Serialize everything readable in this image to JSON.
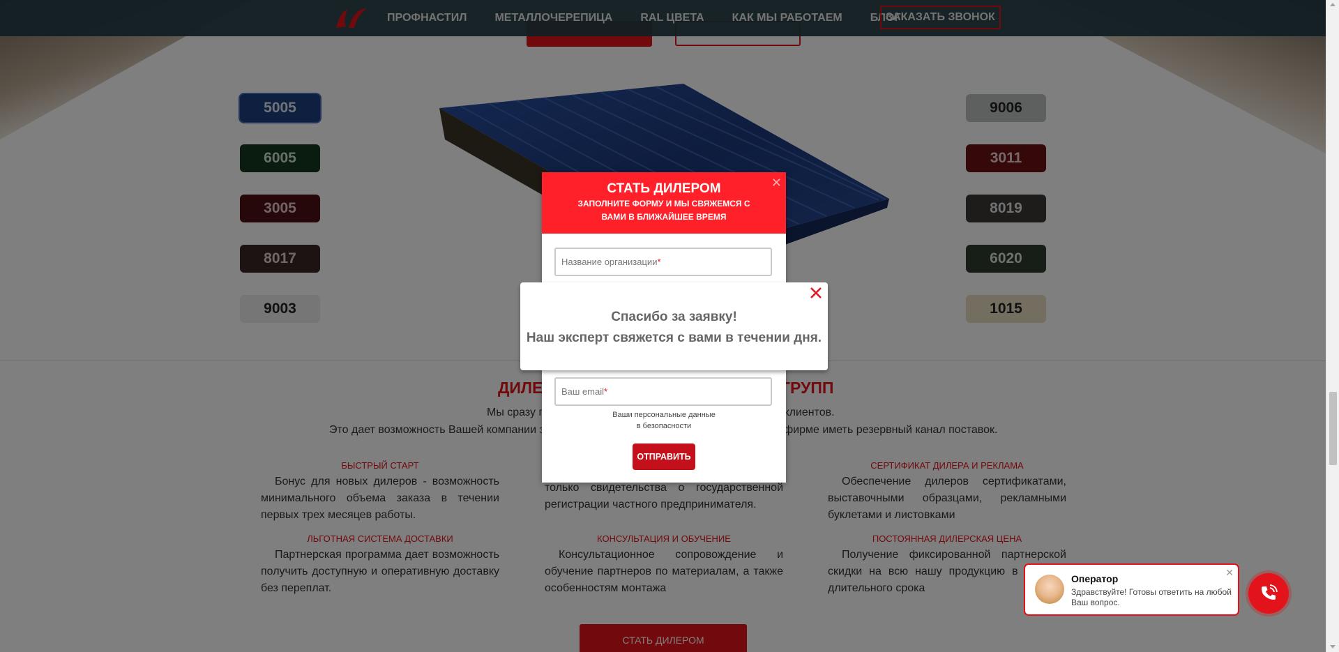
{
  "header": {
    "nav": [
      "ПРОФНАСТИЛ",
      "МЕТАЛЛОЧЕРЕПИЦА",
      "RAL ЦВЕТА",
      "КАК МЫ РАБОТАЕМ",
      "БЛОГ"
    ],
    "cta": "ЗАКАЗАТЬ ЗВОНОК"
  },
  "colors": {
    "left": [
      {
        "code": "5005",
        "bg": "#1e3f7e",
        "fg": "#dfe8f5"
      },
      {
        "code": "6005",
        "bg": "#12391f",
        "fg": "#cfe3d3"
      },
      {
        "code": "3005",
        "bg": "#4e1114",
        "fg": "#e7c8c8"
      },
      {
        "code": "8017",
        "bg": "#3a2725",
        "fg": "#e2d2cf"
      },
      {
        "code": "9003",
        "bg": "#ececec",
        "fg": "#222"
      }
    ],
    "right": [
      {
        "code": "9006",
        "bg": "#bdbebf",
        "fg": "#222"
      },
      {
        "code": "3011",
        "bg": "#6a1114",
        "fg": "#ecd0d0"
      },
      {
        "code": "8019",
        "bg": "#3a3837",
        "fg": "#e3e3e3"
      },
      {
        "code": "6020",
        "bg": "#2f3a2e",
        "fg": "#dce3db"
      },
      {
        "code": "1015",
        "bg": "#e6dcbe",
        "fg": "#222"
      }
    ]
  },
  "dealer": {
    "title_left": "ДИЛЕ",
    "title_right": "ГРУПП",
    "line1_left": "Мы сразу п",
    "line1_right": "х клиентов.",
    "line2_left": "Это дает возможность Вашей компании з",
    "line2_right": "фирме иметь резервный канал поставок.",
    "features": [
      {
        "title": "БЫСТРЫЙ СТАРТ",
        "text": "Бонус для новых дилеров - возможность минимального объема заказа в течении первых трех месяцев работы."
      },
      {
        "title": "",
        "text": "Для начала работы с нами вам достаточно только свидетельства о государственной регистрации частного предпринимателя."
      },
      {
        "title": "СЕРТИФИКАТ ДИЛЕРА И РЕКЛАМА",
        "text": "Обеспечение дилеров сертификатами, выставочными образцами, рекламными буклетами и листовками"
      },
      {
        "title": "ЛЬГОТНАЯ СИСТЕМА ДОСТАВКИ",
        "text": "Партнерская программа дает возможность получить доступную и оперативную доставку без переплат."
      },
      {
        "title": "КОНСУЛЬТАЦИЯ И ОБУЧЕНИЕ",
        "text": "Консультационное сопровождение и обучение партнеров по материалам, а также особенностям монтажа"
      },
      {
        "title": "ПОСТОЯННАЯ ДИЛЕРСКАЯ ЦЕНА",
        "text": "Получение фиксированной партнерской скидки на всю нашу продукцию в течении длительного срока"
      }
    ],
    "cta": "СТАТЬ ДИЛЕРОМ"
  },
  "form": {
    "title": "СТАТЬ ДИЛЕРОМ",
    "subtitle": "ЗАПОЛНИТЕ ФОРМУ И МЫ СВЯЖЕМСЯ С ВАМИ В БЛИЖАЙШЕЕ ВРЕМЯ",
    "org_placeholder": "Название организации",
    "email_placeholder": "Ваш email",
    "required_mark": "*",
    "note_line1": "Ваши персональные данные",
    "note_line2": "в безопасности",
    "submit": "ОТПРАВИТЬ"
  },
  "thanks": {
    "line1": "Спасибо за заявку!",
    "line2": "Наш эксперт свяжется с вами в течении дня."
  },
  "chat": {
    "name": "Оператор",
    "message": "Здравствуйте! Готовы ответить на любой Ваш вопрос."
  }
}
